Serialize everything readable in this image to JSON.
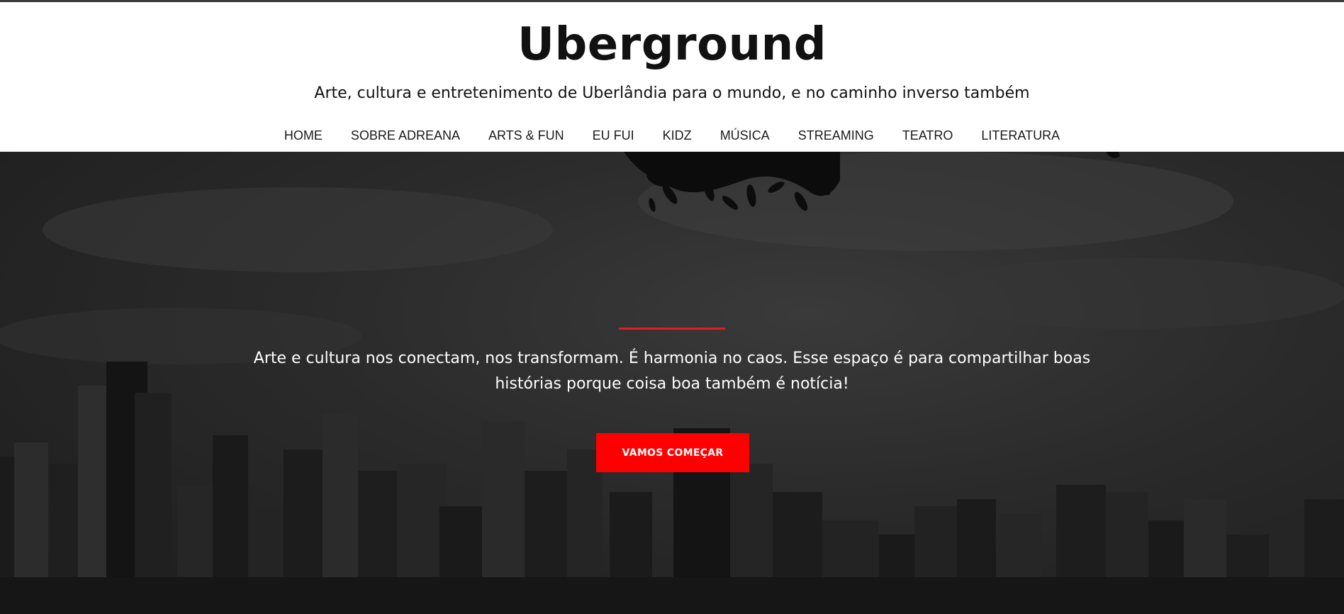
{
  "site": {
    "title": "Uberground",
    "tagline": "Arte, cultura e entretenimento de Uberlândia para o mundo, e no caminho inverso também"
  },
  "nav": {
    "items": [
      {
        "label": "HOME"
      },
      {
        "label": "SOBRE ADREANA"
      },
      {
        "label": "ARTS & FUN"
      },
      {
        "label": "EU FUI"
      },
      {
        "label": "KIDZ"
      },
      {
        "label": "MÚSICA"
      },
      {
        "label": "STREAMING"
      },
      {
        "label": "TEATRO"
      },
      {
        "label": "LITERATURA"
      }
    ]
  },
  "hero": {
    "text": "Arte e cultura nos conectam, nos transformam. É harmonia no caos. Esse espaço é para compartilhar boas histórias porque coisa boa também é notícia!",
    "button_label": "VAMOS COMEÇAR",
    "accent_color": "#ff0000"
  }
}
